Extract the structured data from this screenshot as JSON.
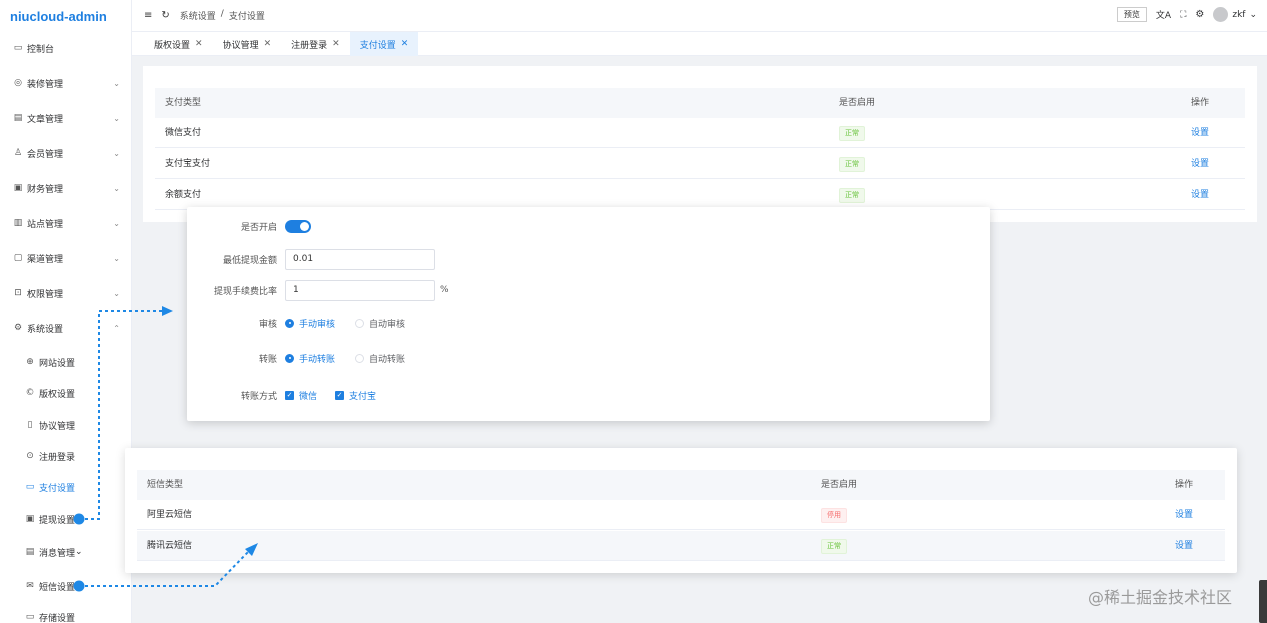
{
  "app": {
    "logo": "niucloud-admin"
  },
  "sidebar": {
    "items": [
      {
        "label": "控制台",
        "icon": "monitor-icon",
        "glyph": "▭"
      },
      {
        "label": "装修管理",
        "icon": "palette-icon",
        "glyph": "◎"
      },
      {
        "label": "文章管理",
        "icon": "document-icon",
        "glyph": "▤"
      },
      {
        "label": "会员管理",
        "icon": "users-icon",
        "glyph": "♙"
      },
      {
        "label": "财务管理",
        "icon": "wallet-icon",
        "glyph": "▣"
      },
      {
        "label": "站点管理",
        "icon": "building-icon",
        "glyph": "▥"
      },
      {
        "label": "渠道管理",
        "icon": "channel-icon",
        "glyph": "▢"
      },
      {
        "label": "权限管理",
        "icon": "lock-icon",
        "glyph": "⊡"
      },
      {
        "label": "系统设置",
        "icon": "gear-icon",
        "glyph": "⚙"
      }
    ],
    "sub_items": [
      {
        "label": "网站设置",
        "icon": "globe-icon",
        "glyph": "⊕"
      },
      {
        "label": "版权设置",
        "icon": "copyright-icon",
        "glyph": "©"
      },
      {
        "label": "协议管理",
        "icon": "book-icon",
        "glyph": "▯"
      },
      {
        "label": "注册登录",
        "icon": "user-circle-icon",
        "glyph": "⊙"
      },
      {
        "label": "支付设置",
        "icon": "card-icon",
        "glyph": "▭"
      },
      {
        "label": "提现设置",
        "icon": "withdraw-icon",
        "glyph": "▣"
      },
      {
        "label": "消息管理",
        "icon": "message-icon",
        "glyph": "▤"
      },
      {
        "label": "短信设置",
        "icon": "mail-icon",
        "glyph": "✉"
      },
      {
        "label": "存储设置",
        "icon": "folder-icon",
        "glyph": "▭"
      }
    ],
    "active_sub": "支付设置"
  },
  "header": {
    "breadcrumb": [
      "系统设置",
      "/",
      "支付设置"
    ],
    "preview_label": "预览",
    "username": "zkf"
  },
  "tabs": [
    {
      "label": "版权设置",
      "active": false
    },
    {
      "label": "协议管理",
      "active": false
    },
    {
      "label": "注册登录",
      "active": false
    },
    {
      "label": "支付设置",
      "active": true
    }
  ],
  "payment_table": {
    "headers": [
      "支付类型",
      "是否启用",
      "操作"
    ],
    "rows": [
      {
        "type": "微信支付",
        "status": "正常",
        "action": "设置"
      },
      {
        "type": "支付宝支付",
        "status": "正常",
        "action": "设置"
      },
      {
        "type": "余额支付",
        "status": "正常",
        "action": "设置"
      }
    ]
  },
  "withdraw_form": {
    "enable_label": "是否开启",
    "enabled": true,
    "min_amount_label": "最低提现金额",
    "min_amount": "0.01",
    "fee_rate_label": "提现手续费比率",
    "fee_rate": "1",
    "fee_rate_suffix": "%",
    "audit_label": "审核",
    "audit_options": [
      "手动审核",
      "自动审核"
    ],
    "audit_selected": "手动审核",
    "transfer_label": "转账",
    "transfer_options": [
      "手动转账",
      "自动转账"
    ],
    "transfer_selected": "手动转账",
    "method_label": "转账方式",
    "methods": [
      "微信",
      "支付宝"
    ]
  },
  "sms_table": {
    "headers": [
      "短信类型",
      "是否启用",
      "操作"
    ],
    "rows": [
      {
        "type": "阿里云短信",
        "status": "停用",
        "action": "设置"
      },
      {
        "type": "腾讯云短信",
        "status": "正常",
        "action": "设置"
      }
    ]
  },
  "watermark": "@稀土掘金技术社区",
  "colors": {
    "accent": "#1e7fe0",
    "success": "#67c23a",
    "danger": "#f56c6c"
  }
}
